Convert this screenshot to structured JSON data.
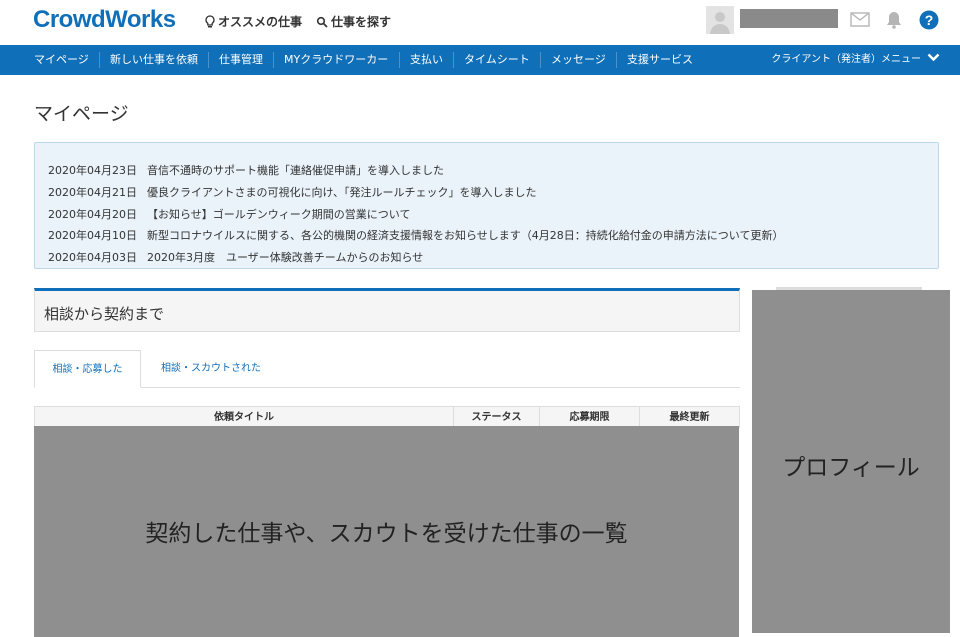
{
  "header": {
    "logo": "CrowdWorks",
    "recommend_label": "オススメの仕事",
    "search_label": "仕事を探す",
    "help_label": "?"
  },
  "nav": {
    "items": [
      {
        "label": "マイページ"
      },
      {
        "label": "新しい仕事を依頼"
      },
      {
        "label": "仕事管理"
      },
      {
        "label": "MYクラウドワーカー"
      },
      {
        "label": "支払い"
      },
      {
        "label": "タイムシート"
      },
      {
        "label": "メッセージ"
      },
      {
        "label": "支援サービス"
      }
    ],
    "client_menu": "クライアント（発注者）メニュー"
  },
  "page": {
    "title": "マイページ"
  },
  "news": [
    {
      "date": "2020年04月23日",
      "text": "音信不通時のサポート機能「連絡催促申請」を導入しました"
    },
    {
      "date": "2020年04月21日",
      "text": "優良クライアントさまの可視化に向け、「発注ルールチェック」を導入しました"
    },
    {
      "date": "2020年04月20日",
      "text": "【お知らせ】ゴールデンウィーク期間の営業について"
    },
    {
      "date": "2020年04月10日",
      "text": "新型コロナウイルスに関する、各公的機関の経済支援情報をお知らせします（4月28日：持続化給付金の申請方法について更新）"
    },
    {
      "date": "2020年04月03日",
      "text": "2020年3月度　ユーザー体験改善チームからのお知らせ"
    }
  ],
  "consult": {
    "title": "相談から契約まで",
    "tabs": [
      {
        "label": "相談・応募した"
      },
      {
        "label": "相談・スカウトされた"
      }
    ],
    "columns": [
      "依頼タイトル",
      "ステータス",
      "応募期限",
      "最終更新"
    ]
  },
  "overlays": {
    "main": "契約した仕事や、スカウトを受けた仕事の一覧",
    "profile": "プロフィール"
  },
  "colors": {
    "brand": "#0f6fb8",
    "news_bg": "#eaf3fa",
    "placeholder": "#8f8f8f"
  }
}
